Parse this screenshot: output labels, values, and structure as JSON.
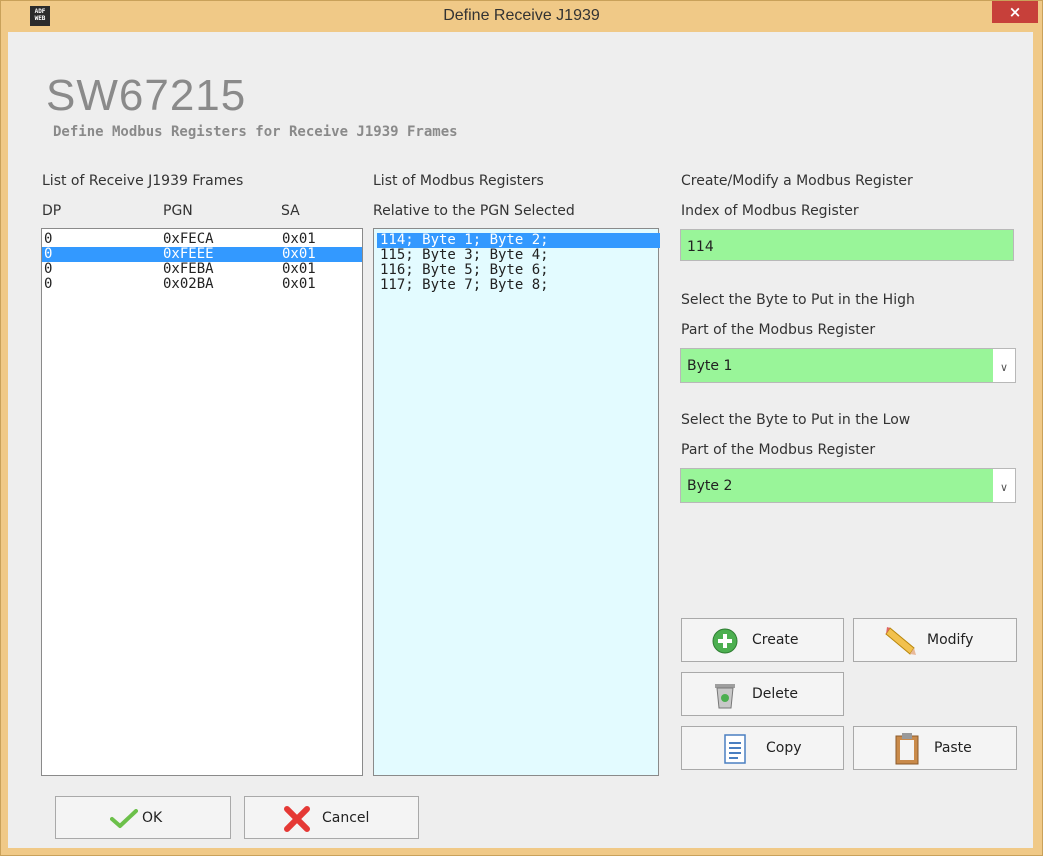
{
  "window": {
    "title": "Define Receive J1939",
    "close_label": "×",
    "icon_text": "ADF\nWEB"
  },
  "header": {
    "app_title": "SW67215",
    "subtitle": "Define Modbus Registers for Receive J1939 Frames"
  },
  "frames": {
    "label": "List of Receive J1939 Frames",
    "col_dp": "DP",
    "col_pgn": "PGN",
    "col_sa": "SA",
    "rows": [
      {
        "dp": "0",
        "pgn": "0xFECA",
        "sa": "0x01"
      },
      {
        "dp": "0",
        "pgn": "0xFEEE",
        "sa": "0x01"
      },
      {
        "dp": "0",
        "pgn": "0xFEBA",
        "sa": "0x01"
      },
      {
        "dp": "0",
        "pgn": "0x02BA",
        "sa": "0x01"
      }
    ]
  },
  "registers": {
    "label1": "List of Modbus Registers",
    "label2": "Relative to the PGN Selected",
    "items": [
      "114; Byte 1; Byte 2;",
      "115; Byte 3; Byte 4;",
      "116; Byte 5; Byte 6;",
      "117; Byte 7; Byte 8;"
    ]
  },
  "editor": {
    "heading": "Create/Modify a Modbus Register",
    "index_label": "Index of Modbus Register",
    "index_value": "114",
    "high_label1": "Select the Byte to Put in the High",
    "high_label2": "Part of the Modbus Register",
    "high_value": "Byte 1",
    "low_label1": "Select the Byte to Put in the Low",
    "low_label2": "Part of the Modbus Register",
    "low_value": "Byte 2"
  },
  "buttons": {
    "create": "Create",
    "modify": "Modify",
    "delete": "Delete",
    "copy": "Copy",
    "paste": "Paste",
    "ok": "OK",
    "cancel": "Cancel"
  },
  "colors": {
    "titlebar": "#f0c987",
    "field_green": "#99f599",
    "selection": "#3399ff",
    "registers_bg": "#e3fbff",
    "close": "#c7403a"
  }
}
